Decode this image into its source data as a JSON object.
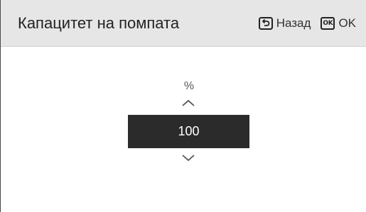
{
  "header": {
    "title": "Капацитет на помпата",
    "back_label": "Назад",
    "ok_icon_text": "OK",
    "ok_label": "OK",
    "back_icon": "back-return-icon",
    "ok_icon": "ok-key-icon"
  },
  "setting": {
    "unit": "%",
    "value": "100",
    "increase_icon": "chevron-up-icon",
    "decrease_icon": "chevron-down-icon"
  },
  "colors": {
    "header_bg": "#e6e6e6",
    "value_bg": "#2b2b2b",
    "value_text": "#ffffff"
  }
}
